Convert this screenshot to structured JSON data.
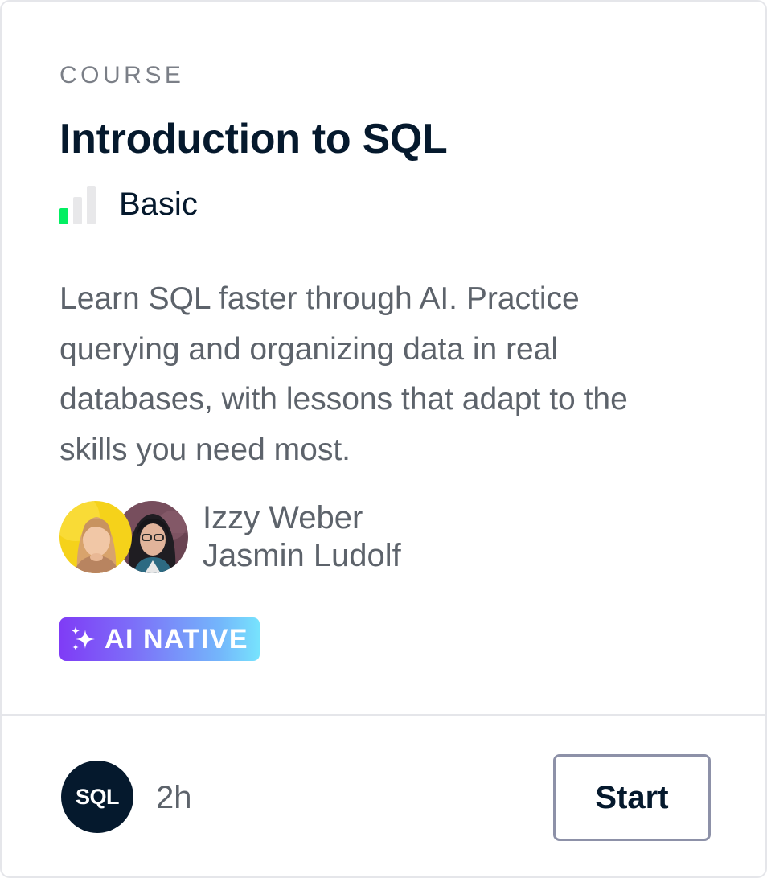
{
  "card": {
    "type_label": "COURSE",
    "title": "Introduction to SQL",
    "level": {
      "label": "Basic",
      "filled_bars": 1,
      "total_bars": 3,
      "active_color": "#03ef62",
      "inactive_color": "#e8e8ea"
    },
    "description": "Learn SQL faster through AI. Practice querying and organizing data in real databases, with lessons that adapt to the skills you need most.",
    "authors": [
      {
        "name": "Izzy Weber",
        "avatar_icon": "avatar-photo"
      },
      {
        "name": "Jasmin Ludolf",
        "avatar_icon": "avatar-photo"
      }
    ],
    "badge": {
      "label": "AI NATIVE",
      "icon": "sparkle-icon"
    },
    "footer": {
      "technology_label": "SQL",
      "duration": "2h",
      "start_label": "Start"
    }
  },
  "colors": {
    "navy": "#05192d",
    "muted_text": "#5d636b",
    "border": "#e5e6ea",
    "button_border": "#8d91a8"
  }
}
